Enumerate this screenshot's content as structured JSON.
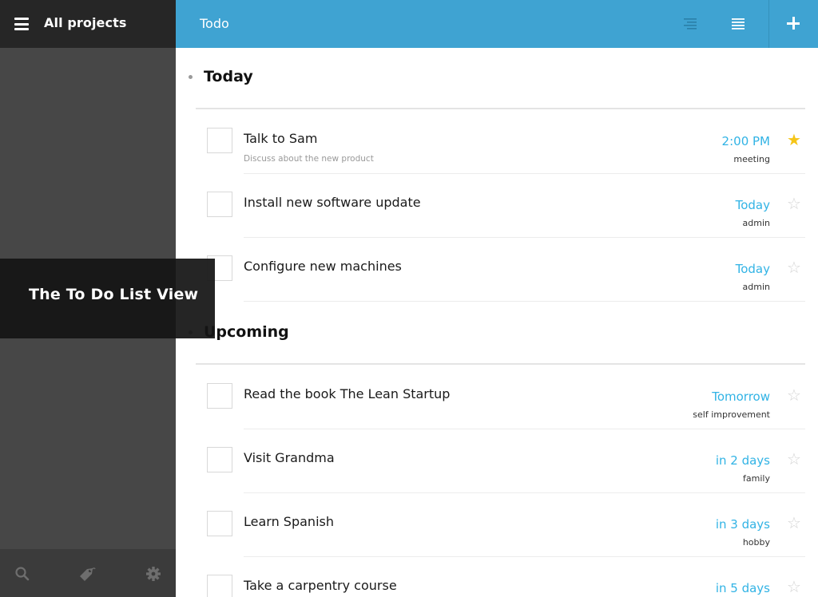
{
  "sidebar": {
    "title": "All projects",
    "footer_icons": [
      "search-icon",
      "tag-icon",
      "gear-icon"
    ]
  },
  "header": {
    "title": "Todo",
    "icons": [
      "compact-list-icon",
      "full-list-icon",
      "plus-icon"
    ]
  },
  "overlay": {
    "label": "The To Do List View"
  },
  "colors": {
    "header_bg": "#3fa3d2",
    "sidebar_bg": "#474747",
    "sidebar_header_bg": "#262626",
    "due_text": "#31b3e5",
    "star_active": "#f5c518"
  },
  "sections": [
    {
      "title": "Today",
      "tasks": [
        {
          "title": "Talk to Sam",
          "note": "Discuss about the new product",
          "due": "2:00 PM",
          "tag": "meeting",
          "starred": true
        },
        {
          "title": "Install new software update",
          "note": "",
          "due": "Today",
          "tag": "admin",
          "starred": false
        },
        {
          "title": "Configure new machines",
          "note": "",
          "due": "Today",
          "tag": "admin",
          "starred": false
        }
      ]
    },
    {
      "title": "Upcoming",
      "tasks": [
        {
          "title": "Read the book The Lean Startup",
          "note": "",
          "due": "Tomorrow",
          "tag": "self improvement",
          "starred": false
        },
        {
          "title": "Visit Grandma",
          "note": "",
          "due": "in 2 days",
          "tag": "family",
          "starred": false
        },
        {
          "title": "Learn Spanish",
          "note": "",
          "due": "in 3 days",
          "tag": "hobby",
          "starred": false
        },
        {
          "title": "Take a carpentry course",
          "note": "",
          "due": "in 5 days",
          "tag": "",
          "starred": false
        }
      ]
    }
  ]
}
